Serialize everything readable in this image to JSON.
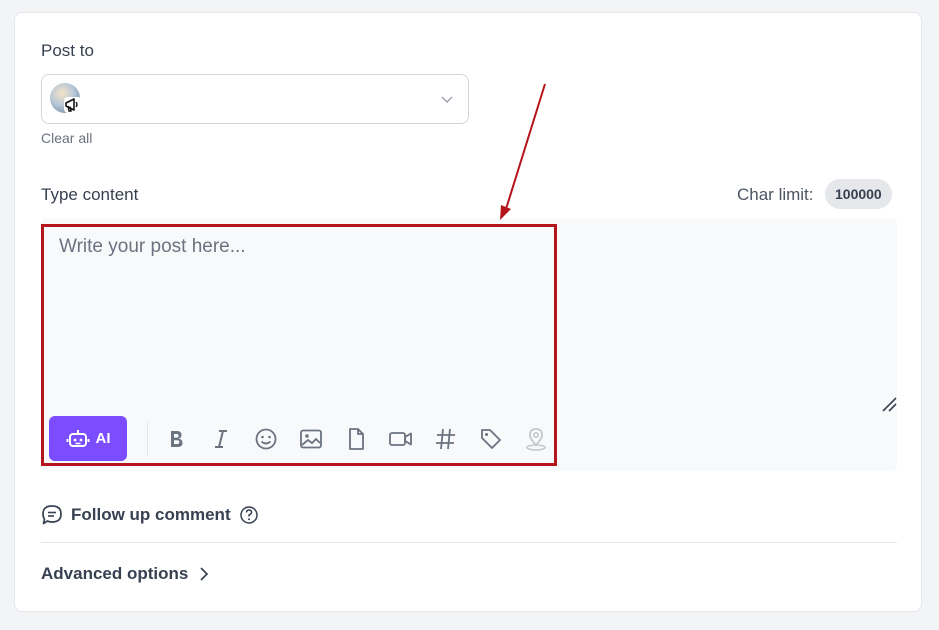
{
  "post_to": {
    "label": "Post to",
    "clear_all": "Clear all"
  },
  "content": {
    "label": "Type content",
    "char_limit_label": "Char limit:",
    "char_limit_value": "100000",
    "placeholder": "Write your post here..."
  },
  "toolbar": {
    "ai_label": "AI",
    "tools": [
      "bold-icon",
      "italic-icon",
      "emoji-icon",
      "image-icon",
      "file-icon",
      "video-icon",
      "hashtag-icon",
      "tag-icon",
      "location-icon"
    ]
  },
  "follow_up": {
    "label": "Follow up comment"
  },
  "advanced": {
    "label": "Advanced options"
  },
  "colors": {
    "accent": "#7c4dff",
    "highlight": "#b4151c"
  }
}
